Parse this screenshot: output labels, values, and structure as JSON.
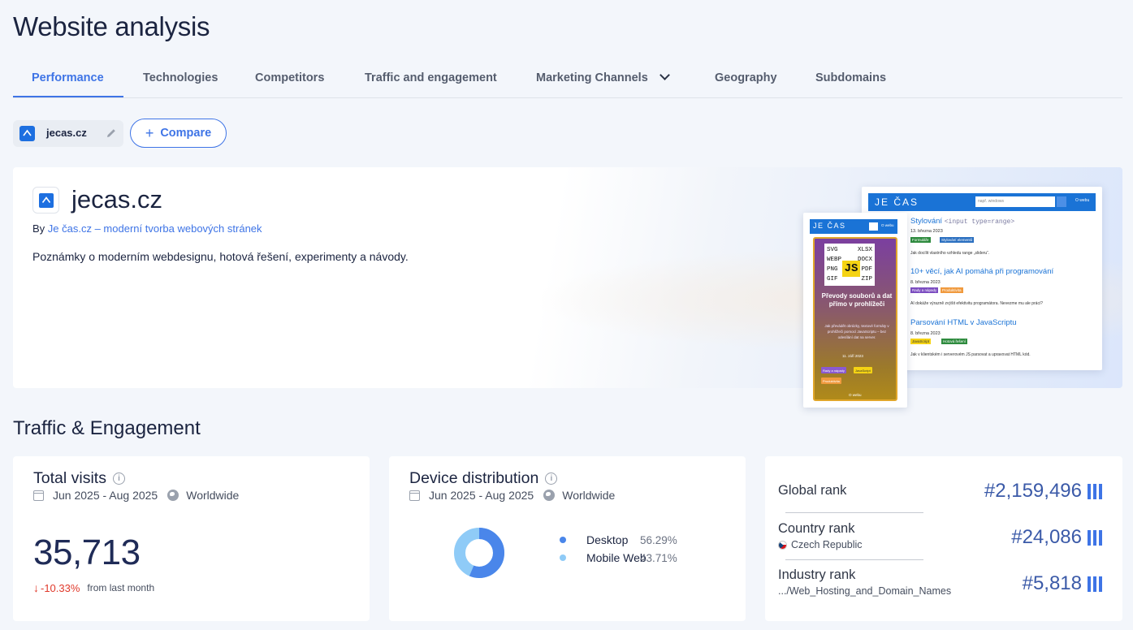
{
  "page": {
    "title": "Website analysis"
  },
  "tabs": [
    {
      "label": "Performance",
      "active": true
    },
    {
      "label": "Technologies"
    },
    {
      "label": "Competitors"
    },
    {
      "label": "Traffic and engagement"
    },
    {
      "label": "Marketing Channels",
      "has_dropdown": true
    },
    {
      "label": "Geography"
    },
    {
      "label": "Subdomains"
    }
  ],
  "site_chip": {
    "domain": "jecas.cz",
    "edit_icon": "pencil-icon"
  },
  "compare": {
    "icon": "plus-icon",
    "label": "Compare"
  },
  "hero": {
    "domain": "jecas.cz",
    "by_prefix": "By",
    "by_link": "Je čas.cz – moderní tvorba webových stránek",
    "description": "Poznámky o moderním webdesignu, hotová řešení, experimenty a návody.",
    "preview_desktop": {
      "logo": "JE ČAS",
      "search_placeholder": "např. windows",
      "nav_link": "O webu",
      "posts": [
        {
          "title": "Stylování",
          "code": "<input type=range>",
          "date": "13. března 2023",
          "tags": [
            "Formuláře",
            "Stylování elementů"
          ],
          "excerpt": "Jak docílit vlastního vzhledu range „slideru“."
        },
        {
          "title": "10+ věcí, jak AI pomáhá při programování",
          "date": "8. března 2023",
          "tags": [
            "Rady a nápady",
            "Produktivita"
          ],
          "excerpt": "AI dokáže výrazně zvýšit efektivitu programátora. Nevezme mu ale práci?"
        },
        {
          "title": "Parsování HTML v JavaScriptu",
          "date": "8. března 2023",
          "tags": [
            "JavaScript",
            "Hotová řešení"
          ],
          "excerpt": "Jak v klientském i serverovém JS parsovat a upravovat HTML kód."
        }
      ]
    },
    "preview_mobile": {
      "logo": "JE ČAS",
      "nav_link": "O webu",
      "files": [
        "SVG",
        "XLSX",
        "WEBP",
        "DOCX",
        "PNG",
        "PDF",
        "GIF",
        "ZIP"
      ],
      "badge": "JS",
      "card_title": "Převody souborů a dat přímo v prohlížeči",
      "card_text": "Jak převádět obrázky, textové formáty v prohlížeči pomocí JavaScriptu – bez odesílání dat na server.",
      "date": "11. září 2023",
      "tags": [
        "Rady a nápady",
        "JavaScript",
        "Produktivita"
      ],
      "footer": "O webu"
    }
  },
  "traffic_section": {
    "title": "Traffic & Engagement"
  },
  "total_visits": {
    "title": "Total visits",
    "date_range": "Jun 2025 - Aug 2025",
    "region": "Worldwide",
    "value": "35,713",
    "change": "-10.33%",
    "change_suffix": "from last month",
    "change_color": "#e0392b"
  },
  "device_distribution": {
    "title": "Device distribution",
    "date_range": "Jun 2025 - Aug 2025",
    "region": "Worldwide",
    "items": [
      {
        "label": "Desktop",
        "pct": "56.29%",
        "value": 56.29,
        "color": "#4a86ea"
      },
      {
        "label": "Mobile Web",
        "pct": "43.71%",
        "value": 43.71,
        "color": "#8fcbf7"
      }
    ]
  },
  "ranks": {
    "global": {
      "label": "Global rank",
      "value": "#2,159,496"
    },
    "country": {
      "label": "Country rank",
      "sub": "Czech Republic",
      "value": "#24,086"
    },
    "industry": {
      "label": "Industry rank",
      "sub": ".../Web_Hosting_and_Domain_Names",
      "value": "#5,818"
    }
  },
  "colors": {
    "accent": "#3e74e6",
    "negative": "#e0392b"
  }
}
